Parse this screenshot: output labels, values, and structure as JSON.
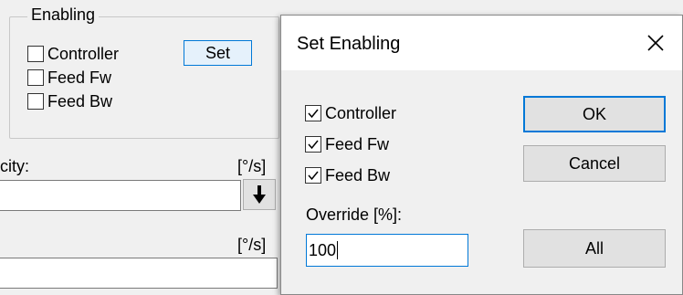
{
  "enabling_group": {
    "title": "Enabling",
    "checkboxes": [
      {
        "label": "Controller",
        "checked": false
      },
      {
        "label": "Feed Fw",
        "checked": false
      },
      {
        "label": "Feed Bw",
        "checked": false
      }
    ],
    "set_label": "Set"
  },
  "velocity": {
    "label": "city:",
    "unit": "[°/s]",
    "arrow_icon": "arrow-down-icon"
  },
  "second_field": {
    "unit": "[°/s]"
  },
  "dialog": {
    "title": "Set Enabling",
    "checkboxes": [
      {
        "label": "Controller",
        "checked": true
      },
      {
        "label": "Feed Fw",
        "checked": true
      },
      {
        "label": "Feed Bw",
        "checked": true
      }
    ],
    "ok_label": "OK",
    "cancel_label": "Cancel",
    "all_label": "All",
    "override_label": "Override [%]:",
    "override_value": "100",
    "accent_color": "#0078d7"
  }
}
